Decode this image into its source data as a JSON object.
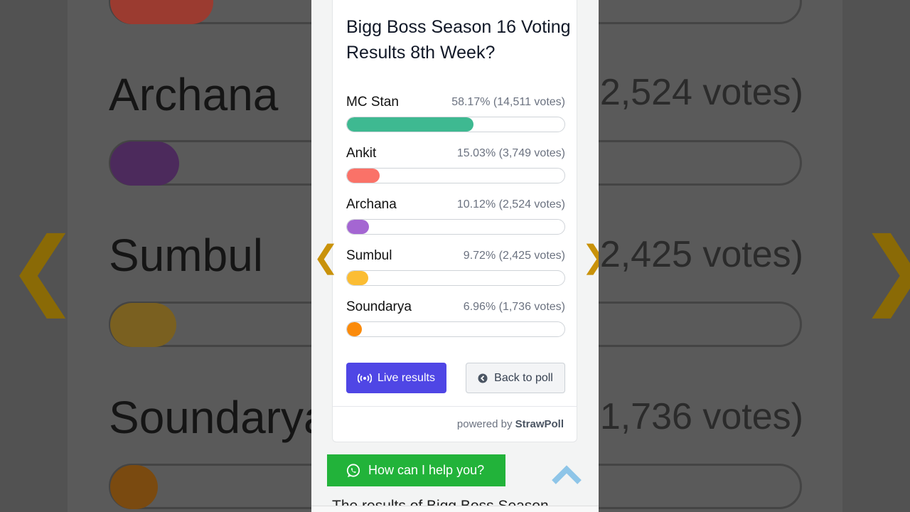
{
  "poll": {
    "title": "Bigg Boss Season 16 Voting Results 8th Week?",
    "options": [
      {
        "name": "MC Stan",
        "result": "58.17% (14,511 votes)",
        "percent": 58.17,
        "color": "#3eb991"
      },
      {
        "name": "Ankit",
        "result": "15.03% (3,749 votes)",
        "percent": 15.03,
        "color": "#fa7268"
      },
      {
        "name": "Archana",
        "result": "10.12% (2,524 votes)",
        "percent": 10.12,
        "color": "#a466d2"
      },
      {
        "name": "Sumbul",
        "result": "9.72% (2,425 votes)",
        "percent": 9.72,
        "color": "#fbbd33"
      },
      {
        "name": "Soundarya",
        "result": "6.96% (1,736 votes)",
        "percent": 6.96,
        "color": "#fb8b0b"
      }
    ],
    "live_results_label": "Live results",
    "back_to_poll_label": "Back to poll",
    "powered_prefix": "powered by",
    "powered_brand": "StrawPoll"
  },
  "nav": {
    "prev_glyph": "❮",
    "next_glyph": "❯"
  },
  "whatsapp": {
    "label": "How can I help you?"
  },
  "article": {
    "partial_text": "The results of Bigg Boss Season"
  },
  "background": {
    "names": [
      "Archana",
      "Sumbul",
      "Soundarya"
    ],
    "votes": [
      "2,524 votes)",
      "2,425 votes)",
      "1,736 votes)"
    ]
  },
  "colors": {
    "accent": "#4f46e5",
    "whatsapp": "#22b33a"
  }
}
